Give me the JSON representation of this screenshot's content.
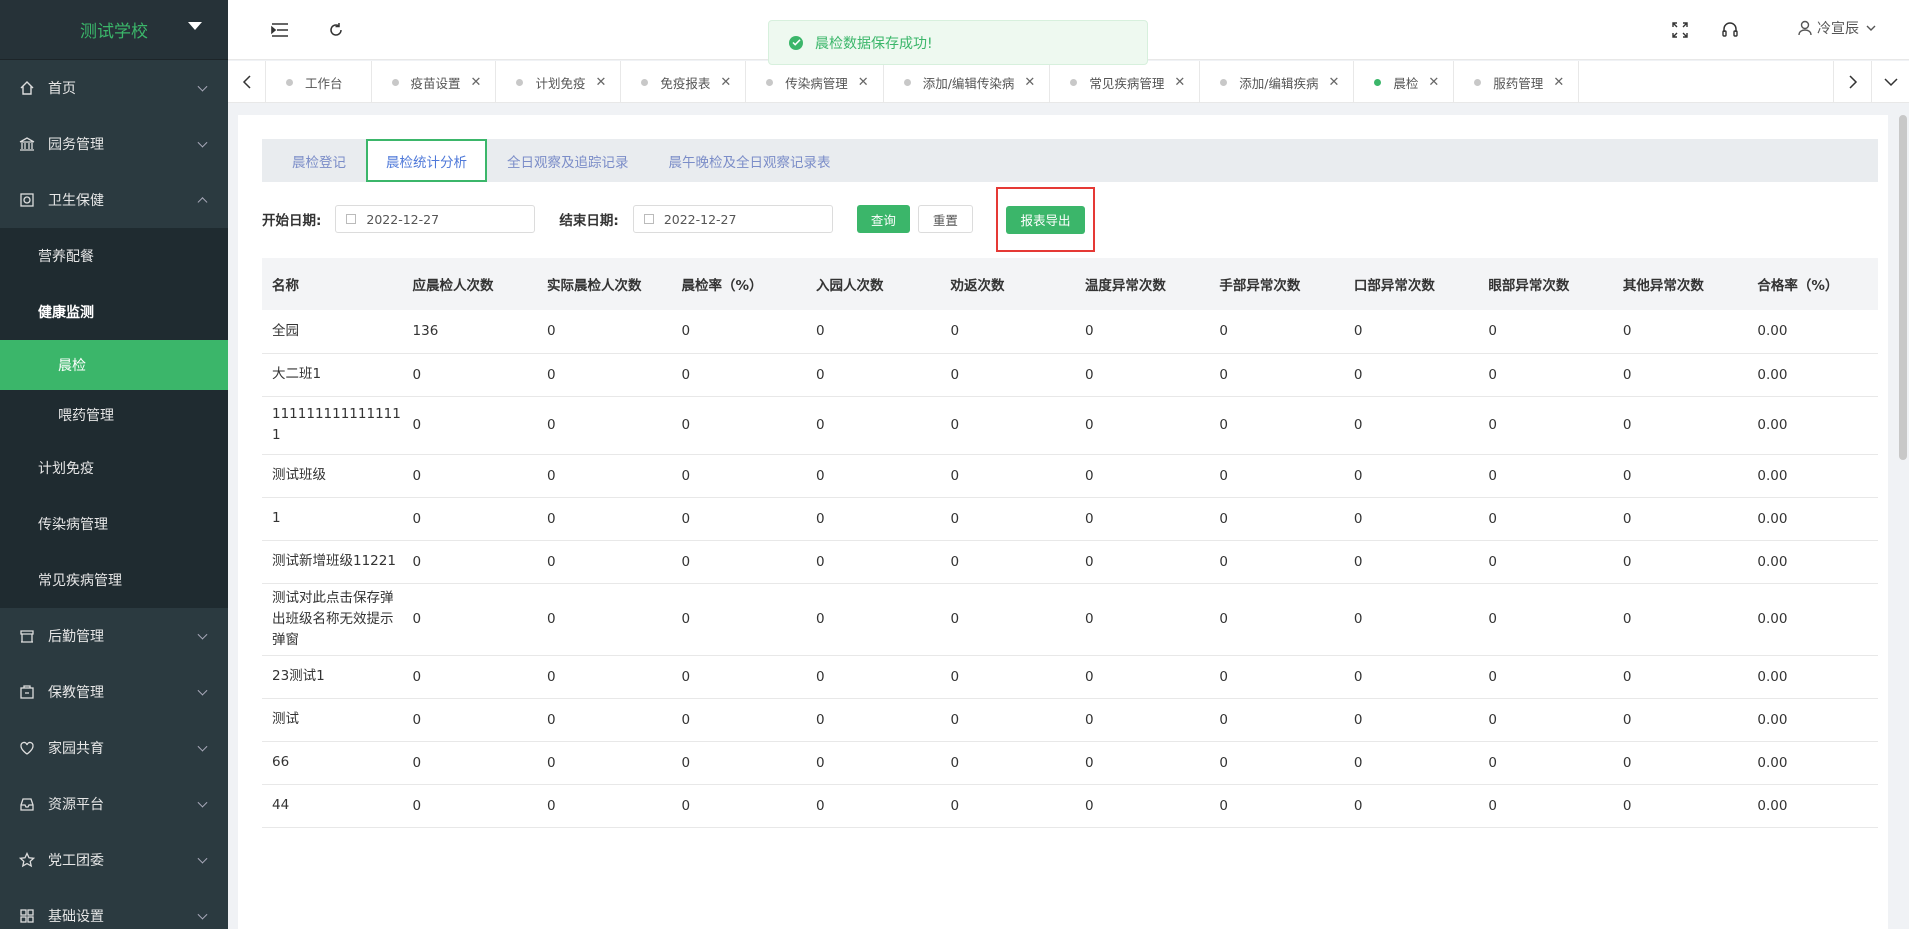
{
  "brand": {
    "school_name": "测试学校"
  },
  "sidebar": {
    "items": [
      {
        "label": "首页",
        "icon": "home-icon"
      },
      {
        "label": "园务管理",
        "icon": "bank-icon"
      },
      {
        "label": "卫生保健",
        "icon": "health-icon",
        "expanded": true
      }
    ],
    "health_children": [
      {
        "label": "营养配餐"
      },
      {
        "label": "健康监测",
        "expanded": true
      }
    ],
    "monitoring_children": [
      {
        "label": "晨检",
        "active": true
      },
      {
        "label": "喂药管理"
      }
    ],
    "health_children_after": [
      {
        "label": "计划免疫"
      },
      {
        "label": "传染病管理"
      },
      {
        "label": "常见疾病管理"
      }
    ],
    "items_after": [
      {
        "label": "后勤管理",
        "icon": "logistics-icon"
      },
      {
        "label": "保教管理",
        "icon": "education-icon"
      },
      {
        "label": "家园共育",
        "icon": "heart-icon"
      },
      {
        "label": "资源平台",
        "icon": "inbox-icon"
      },
      {
        "label": "党工团委",
        "icon": "star-icon"
      },
      {
        "label": "基础设置",
        "icon": "grid-icon"
      }
    ]
  },
  "header": {
    "toast": "晨检数据保存成功!",
    "user_name": "冷宣辰"
  },
  "tabs": [
    {
      "label": "工作台",
      "closable": false,
      "active": false
    },
    {
      "label": "疫苗设置",
      "closable": true,
      "active": false
    },
    {
      "label": "计划免疫",
      "closable": true,
      "active": false
    },
    {
      "label": "免疫报表",
      "closable": true,
      "active": false
    },
    {
      "label": "传染病管理",
      "closable": true,
      "active": false
    },
    {
      "label": "添加/编辑传染病",
      "closable": true,
      "active": false
    },
    {
      "label": "常见疾病管理",
      "closable": true,
      "active": false
    },
    {
      "label": "添加/编辑疾病",
      "closable": true,
      "active": false
    },
    {
      "label": "晨检",
      "closable": true,
      "active": true
    },
    {
      "label": "服药管理",
      "closable": true,
      "active": false
    }
  ],
  "subtabs": [
    {
      "label": "晨检登记",
      "active": false
    },
    {
      "label": "晨检统计分析",
      "active": true
    },
    {
      "label": "全日观察及追踪记录",
      "active": false
    },
    {
      "label": "晨午晚检及全日观察记录表",
      "active": false
    }
  ],
  "filters": {
    "start_label": "开始日期:",
    "start_value": "2022-12-27",
    "end_label": "结束日期:",
    "end_value": "2022-12-27",
    "query_label": "查询",
    "reset_label": "重置",
    "export_label": "报表导出"
  },
  "table": {
    "headers": [
      "名称",
      "应晨检人次数",
      "实际晨检人次数",
      "晨检率（%）",
      "入园人次数",
      "劝返次数",
      "温度异常次数",
      "手部异常次数",
      "口部异常次数",
      "眼部异常次数",
      "其他异常次数",
      "合格率（%）"
    ],
    "rows": [
      [
        "全园",
        "136",
        "0",
        "0",
        "0",
        "0",
        "0",
        "0",
        "0",
        "0",
        "0",
        "0.00"
      ],
      [
        "大二班1",
        "0",
        "0",
        "0",
        "0",
        "0",
        "0",
        "0",
        "0",
        "0",
        "0",
        "0.00"
      ],
      [
        "1111111111111111",
        "0",
        "0",
        "0",
        "0",
        "0",
        "0",
        "0",
        "0",
        "0",
        "0",
        "0.00"
      ],
      [
        "测试班级",
        "0",
        "0",
        "0",
        "0",
        "0",
        "0",
        "0",
        "0",
        "0",
        "0",
        "0.00"
      ],
      [
        "1",
        "0",
        "0",
        "0",
        "0",
        "0",
        "0",
        "0",
        "0",
        "0",
        "0",
        "0.00"
      ],
      [
        "测试新增班级11221",
        "0",
        "0",
        "0",
        "0",
        "0",
        "0",
        "0",
        "0",
        "0",
        "0",
        "0.00"
      ],
      [
        "测试对此点击保存弹出班级名称无效提示弹窗",
        "0",
        "0",
        "0",
        "0",
        "0",
        "0",
        "0",
        "0",
        "0",
        "0",
        "0.00"
      ],
      [
        "23测试1",
        "0",
        "0",
        "0",
        "0",
        "0",
        "0",
        "0",
        "0",
        "0",
        "0",
        "0.00"
      ],
      [
        "测试",
        "0",
        "0",
        "0",
        "0",
        "0",
        "0",
        "0",
        "0",
        "0",
        "0",
        "0.00"
      ],
      [
        "66",
        "0",
        "0",
        "0",
        "0",
        "0",
        "0",
        "0",
        "0",
        "0",
        "0",
        "0.00"
      ],
      [
        "44",
        "0",
        "0",
        "0",
        "0",
        "0",
        "0",
        "0",
        "0",
        "0",
        "0",
        "0.00"
      ]
    ]
  },
  "colors": {
    "accent": "#3bb66a",
    "sidebar_bg": "#2b3a40",
    "highlight": "#e53935"
  }
}
